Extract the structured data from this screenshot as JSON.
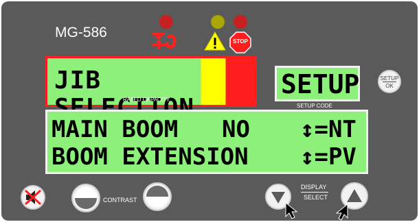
{
  "device": {
    "model": "MG-586",
    "icons": [
      "crane-hook-icon",
      "warning-triangle-icon",
      "stop-sign-icon"
    ],
    "stop_text": "STOP"
  },
  "display_main": {
    "text": "JIB SELECTION",
    "caption": "RATED CAPACITY",
    "colors": {
      "green": "#8cf07a",
      "yellow": "#ffff00",
      "red": "#ff1e1e"
    }
  },
  "display_setup": {
    "text": "SETUP",
    "caption": "SETUP CODE"
  },
  "setup_ok_button": {
    "top": "SETUP",
    "bottom": "OK"
  },
  "display_lower": {
    "line1_left": "MAIN BOOM",
    "line1_mid": "NO",
    "line1_right": "↕=NT",
    "line2_left": "BOOM EXTENSION",
    "line2_right": "↕=PV"
  },
  "controls": {
    "contrast_label": "CONTRAST",
    "display_label_top": "DISPLAY",
    "display_label_bottom": "SELECT"
  }
}
